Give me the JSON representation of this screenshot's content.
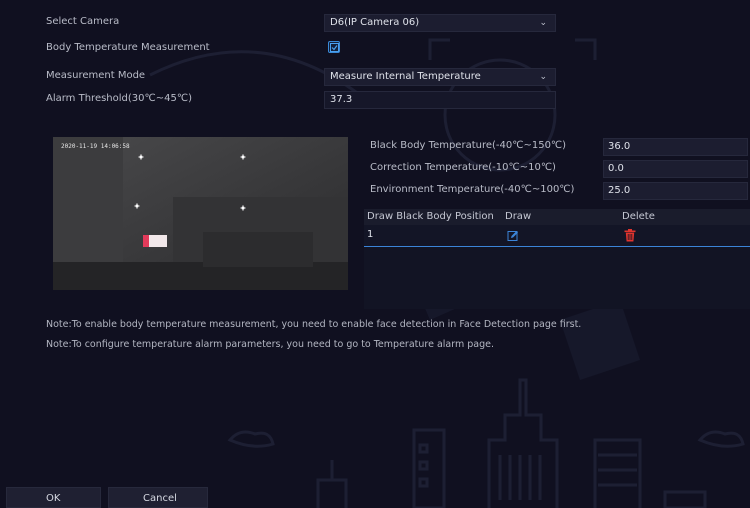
{
  "form": {
    "select_camera": {
      "label": "Select Camera",
      "value": "D6(IP Camera 06)"
    },
    "body_temp": {
      "label": "Body Temperature Measurement",
      "checked": true
    },
    "measurement_mode": {
      "label": "Measurement Mode",
      "value": "Measure Internal Temperature"
    },
    "alarm_threshold": {
      "label": "Alarm Threshold(30℃~45℃)",
      "value": "37.3"
    }
  },
  "preview": {
    "timestamp": "2020-11-19 14:06:58"
  },
  "params": {
    "black_body_temp": {
      "label": "Black Body Temperature(-40℃~150℃)",
      "value": "36.0"
    },
    "correction_temp": {
      "label": "Correction Temperature(-10℃~10℃)",
      "value": "0.0"
    },
    "environment_temp": {
      "label": "Environment Temperature(-40℃~100℃)",
      "value": "25.0"
    }
  },
  "table": {
    "headers": [
      "Draw Black Body Position",
      "Draw",
      "Delete"
    ],
    "rows": [
      {
        "position": "1"
      }
    ]
  },
  "notes": {
    "note1": "Note:To enable body temperature measurement, you need to enable face detection in Face Detection page first.",
    "note2": "Note:To configure temperature alarm parameters, you need to go to Temperature alarm page."
  },
  "buttons": {
    "ok": "OK",
    "cancel": "Cancel"
  },
  "colors": {
    "accent": "#3b84d8",
    "delete": "#e0342e",
    "background": "#101020"
  },
  "icons": {
    "dropdown": "chevron-down-icon",
    "draw": "edit-icon",
    "delete": "trash-icon",
    "checkbox": "checkmark-icon"
  }
}
